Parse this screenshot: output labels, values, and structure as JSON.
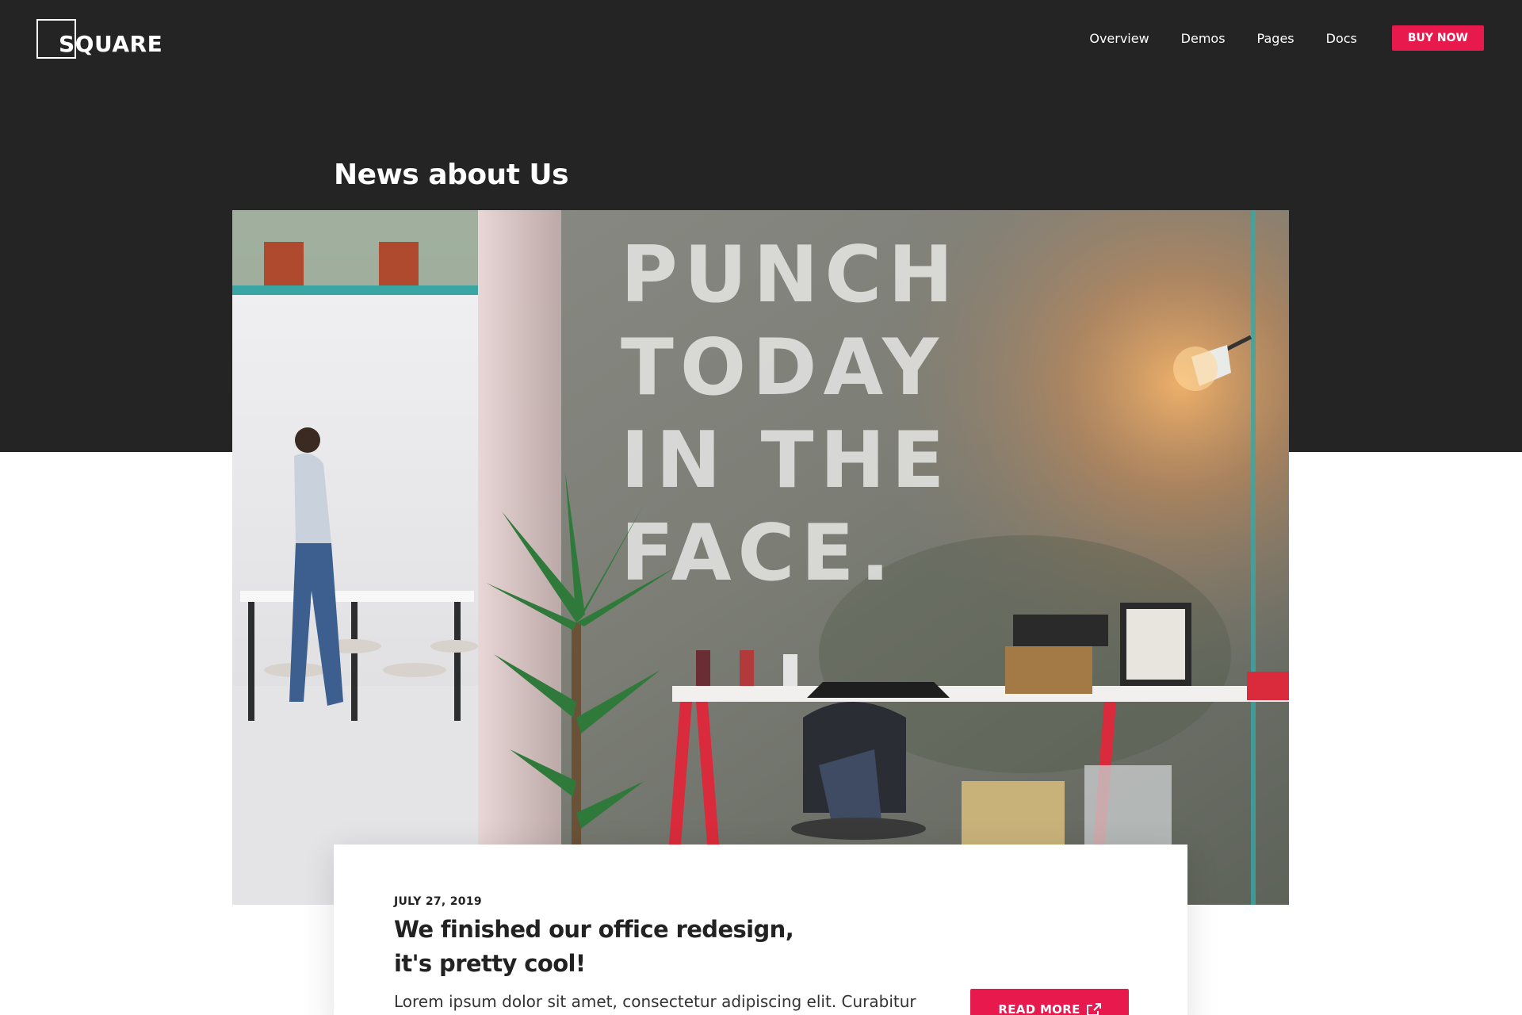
{
  "brand": {
    "logo_text": "SQUARE"
  },
  "nav": {
    "items": [
      {
        "label": "Overview"
      },
      {
        "label": "Demos"
      },
      {
        "label": "Pages"
      },
      {
        "label": "Docs"
      }
    ],
    "cta_label": "BUY NOW"
  },
  "section": {
    "title": "News about Us"
  },
  "hero": {
    "wall_lettering": [
      "PUNCH",
      "TODAY",
      "IN THE",
      "FACE."
    ]
  },
  "post": {
    "date": "JULY 27, 2019",
    "title_line1": "We finished our office redesign,",
    "title_line2": "it's pretty cool!",
    "excerpt": "Lorem ipsum dolor sit amet, consectetur adipiscing elit. Curabitur",
    "read_more_label": "READ MORE"
  },
  "colors": {
    "dark_band": "#242424",
    "accent": "#e81a4d",
    "white": "#ffffff"
  },
  "icons": {
    "read_more": "external-link-icon"
  }
}
